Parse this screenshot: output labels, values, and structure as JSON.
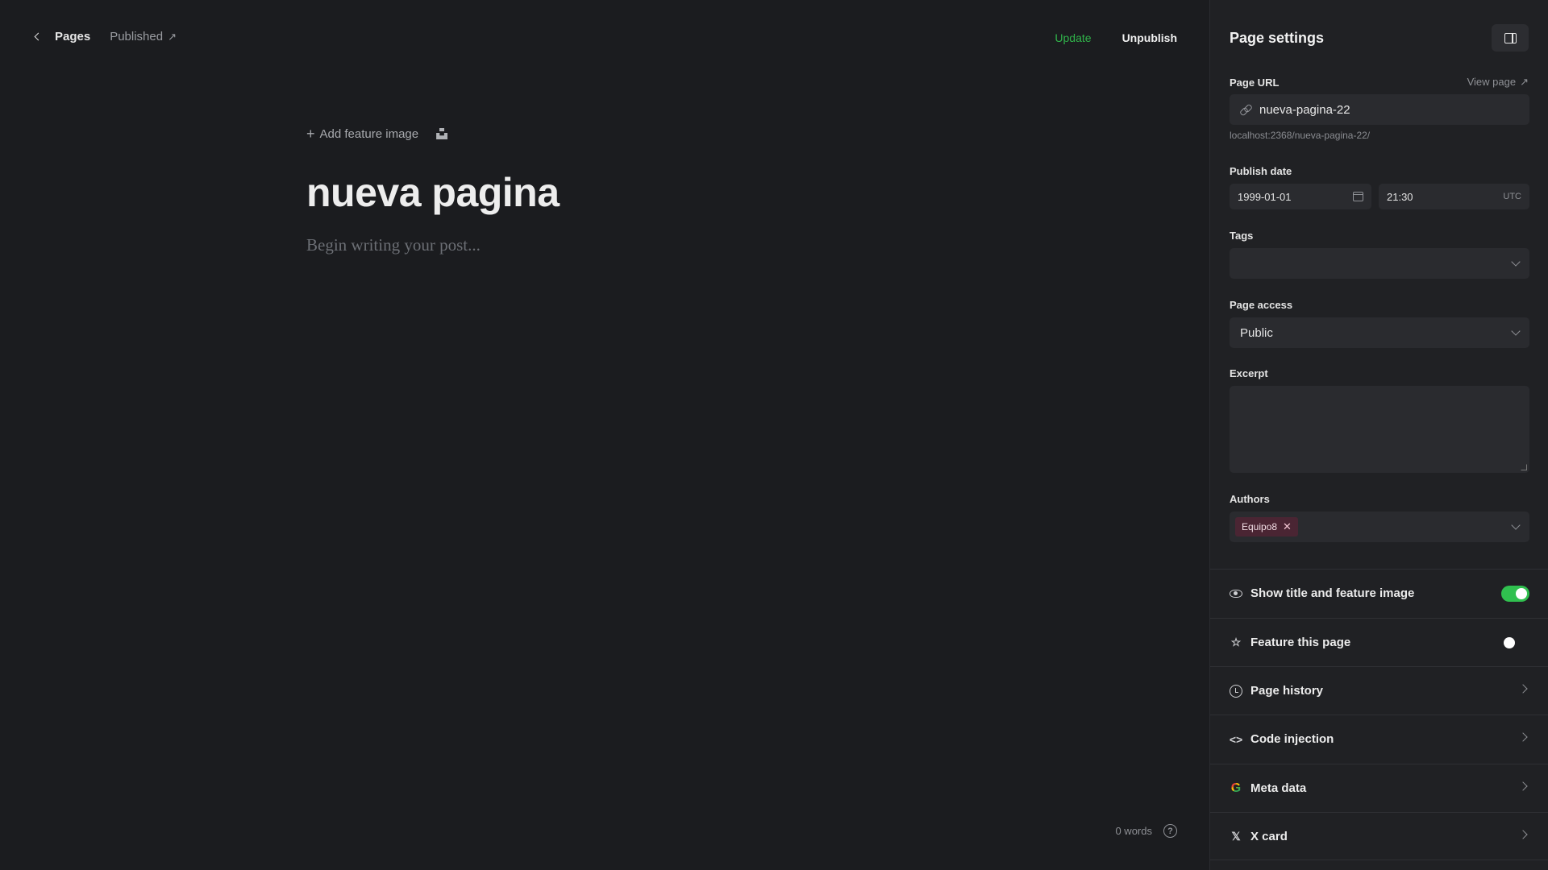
{
  "editor": {
    "breadcrumb": {
      "back_label": "Pages",
      "status": "Published"
    },
    "actions": {
      "update": "Update",
      "unpublish": "Unpublish"
    },
    "add_feature_image": "Add feature image",
    "title": "nueva pagina",
    "body_placeholder": "Begin writing your post...",
    "word_count": "0 words"
  },
  "settings": {
    "title": "Page settings",
    "page_url": {
      "label": "Page URL",
      "view_page": "View page",
      "value": "nueva-pagina-22",
      "hint": "localhost:2368/nueva-pagina-22/"
    },
    "publish_date": {
      "label": "Publish date",
      "date": "1999-01-01",
      "time": "21:30",
      "timezone": "UTC"
    },
    "tags": {
      "label": "Tags",
      "value": ""
    },
    "page_access": {
      "label": "Page access",
      "value": "Public"
    },
    "excerpt": {
      "label": "Excerpt",
      "value": ""
    },
    "authors": {
      "label": "Authors",
      "chips": [
        "Equipo8"
      ]
    },
    "options": [
      {
        "label": "Show title and feature image",
        "icon": "eye-icon",
        "toggle": true
      },
      {
        "label": "Feature this page",
        "icon": "star-icon",
        "toggle": false
      },
      {
        "label": "Page history",
        "icon": "history-icon"
      },
      {
        "label": "Code injection",
        "icon": "code-icon"
      },
      {
        "label": "Meta data",
        "icon": "google-icon"
      },
      {
        "label": "X card",
        "icon": "x-icon"
      }
    ]
  },
  "colors": {
    "accent_green": "#30b34a",
    "chip_bg": "#4a2533",
    "background": "#1b1c1f",
    "panel": "#202124"
  }
}
